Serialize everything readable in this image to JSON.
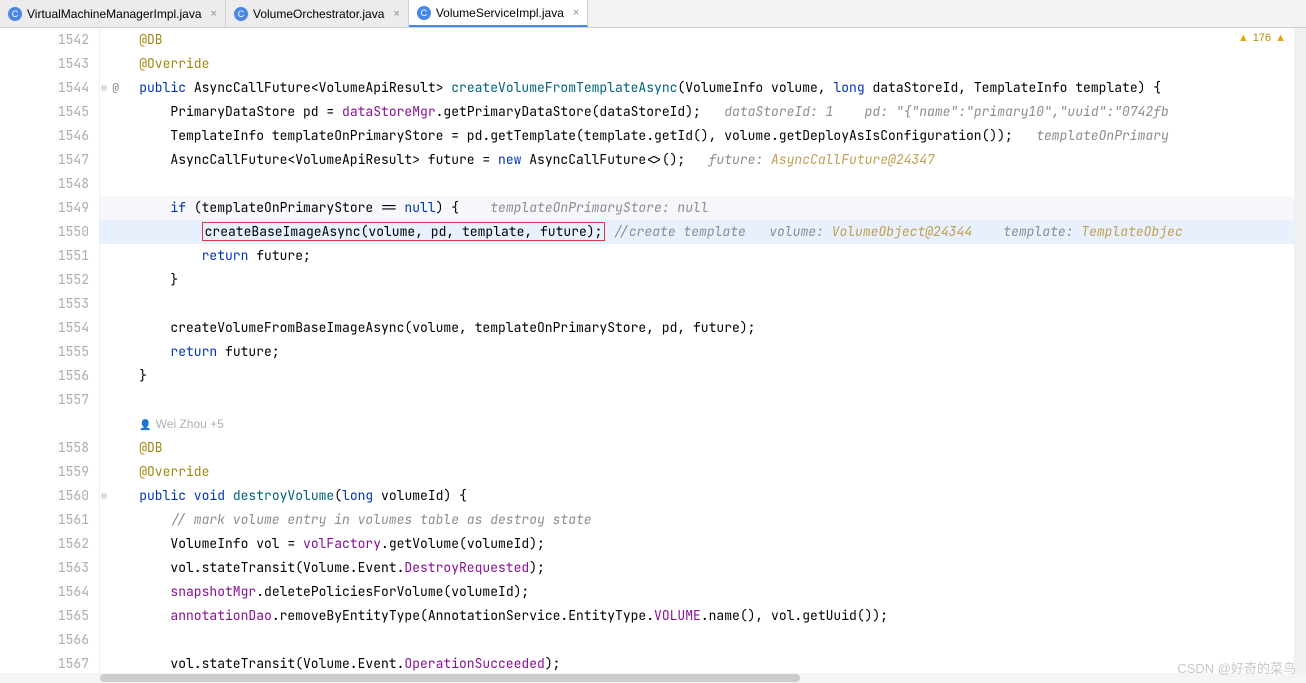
{
  "tabs": [
    {
      "label": "VirtualMachineManagerImpl.java",
      "active": false
    },
    {
      "label": "VolumeOrchestrator.java",
      "active": false
    },
    {
      "label": "VolumeServiceImpl.java",
      "active": true
    }
  ],
  "warn_count": "176",
  "watermark": "CSDN @好奇的菜鸟",
  "author_line": "Wei Zhou +5",
  "gutter_start": 1542,
  "lines": [
    {
      "n": 1542,
      "tokens": [
        [
          "    ",
          ""
        ],
        [
          "@DB",
          "ann"
        ]
      ]
    },
    {
      "n": 1543,
      "tokens": [
        [
          "    ",
          ""
        ],
        [
          "@Override",
          "ann"
        ]
      ]
    },
    {
      "n": 1544,
      "marker": "bp-at",
      "fold": true,
      "tokens": [
        [
          "    ",
          ""
        ],
        [
          "public ",
          "kw"
        ],
        [
          "AsyncCallFuture<VolumeApiResult> ",
          ""
        ],
        [
          "createVolumeFromTemplateAsync",
          "method-def"
        ],
        [
          "(VolumeInfo volume, ",
          ""
        ],
        [
          "long ",
          "kw"
        ],
        [
          "dataStoreId, TemplateInfo template) {",
          ""
        ]
      ]
    },
    {
      "n": 1545,
      "tokens": [
        [
          "        PrimaryDataStore pd = ",
          ""
        ],
        [
          "dataStoreMgr",
          "field"
        ],
        [
          ".getPrimaryDataStore(dataStoreId);   ",
          ""
        ],
        [
          "dataStoreId: 1    pd: \"{\"name\":\"primary10\",\"uuid\":\"0742fb",
          "hint2"
        ]
      ]
    },
    {
      "n": 1546,
      "tokens": [
        [
          "        TemplateInfo templateOnPrimaryStore = pd.getTemplate(template.getId(), volume.getDeployAsIsConfiguration());   ",
          ""
        ],
        [
          "templateOnPrimary",
          "hint2"
        ]
      ]
    },
    {
      "n": 1547,
      "tokens": [
        [
          "        AsyncCallFuture<VolumeApiResult> future = ",
          ""
        ],
        [
          "new ",
          "kw"
        ],
        [
          "AsyncCallFuture<>();   ",
          ""
        ],
        [
          "future: ",
          "hint2"
        ],
        [
          "AsyncCallFuture@24347",
          "hint"
        ]
      ]
    },
    {
      "n": 1548,
      "tokens": [
        [
          "",
          ""
        ]
      ]
    },
    {
      "n": 1549,
      "hl": "hl-line",
      "tokens": [
        [
          "        ",
          ""
        ],
        [
          "if ",
          "kw"
        ],
        [
          "(templateOnPrimaryStore == ",
          ""
        ],
        [
          "null",
          "kw"
        ],
        [
          ") {    ",
          ""
        ],
        [
          "templateOnPrimaryStore: null",
          "hint2"
        ]
      ]
    },
    {
      "n": 1550,
      "hl": "hl-current",
      "box": true,
      "tokens_pre": "            ",
      "boxed": "createBaseImageAsync(volume, pd, template, future);",
      "tokens_post": [
        [
          " ",
          ""
        ],
        [
          "//create template   ",
          "hint2"
        ],
        [
          "volume: ",
          "hint2"
        ],
        [
          "VolumeObject@24344",
          "hint"
        ],
        [
          "    template: ",
          "hint2"
        ],
        [
          "TemplateObjec",
          "hint"
        ]
      ]
    },
    {
      "n": 1551,
      "tokens": [
        [
          "            ",
          ""
        ],
        [
          "return ",
          "kw"
        ],
        [
          "future;",
          ""
        ]
      ]
    },
    {
      "n": 1552,
      "tokens": [
        [
          "        }",
          ""
        ]
      ]
    },
    {
      "n": 1553,
      "tokens": [
        [
          "",
          ""
        ]
      ]
    },
    {
      "n": 1554,
      "tokens": [
        [
          "        createVolumeFromBaseImageAsync(volume, templateOnPrimaryStore, pd, future);",
          ""
        ]
      ]
    },
    {
      "n": 1555,
      "tokens": [
        [
          "        ",
          ""
        ],
        [
          "return ",
          "kw"
        ],
        [
          "future;",
          ""
        ]
      ]
    },
    {
      "n": 1556,
      "tokens": [
        [
          "    }",
          ""
        ]
      ]
    },
    {
      "n": 1557,
      "tokens": [
        [
          "",
          ""
        ]
      ]
    },
    {
      "n": "author",
      "tokens": []
    },
    {
      "n": 1558,
      "tokens": [
        [
          "    ",
          ""
        ],
        [
          "@DB",
          "ann"
        ]
      ]
    },
    {
      "n": 1559,
      "tokens": [
        [
          "    ",
          ""
        ],
        [
          "@Override",
          "ann"
        ]
      ]
    },
    {
      "n": 1560,
      "marker": "bp",
      "fold": true,
      "tokens": [
        [
          "    ",
          ""
        ],
        [
          "public void ",
          "kw"
        ],
        [
          "destroyVolume",
          "method-def"
        ],
        [
          "(",
          ""
        ],
        [
          "long ",
          "kw"
        ],
        [
          "volumeId) {",
          ""
        ]
      ]
    },
    {
      "n": 1561,
      "tokens": [
        [
          "        ",
          ""
        ],
        [
          "// mark volume entry in volumes table as destroy state",
          "comment"
        ]
      ]
    },
    {
      "n": 1562,
      "tokens": [
        [
          "        VolumeInfo vol = ",
          ""
        ],
        [
          "volFactory",
          "field"
        ],
        [
          ".getVolume(volumeId);",
          ""
        ]
      ]
    },
    {
      "n": 1563,
      "tokens": [
        [
          "        vol.stateTransit(Volume.Event.",
          ""
        ],
        [
          "DestroyRequested",
          "field"
        ],
        [
          ");",
          ""
        ]
      ]
    },
    {
      "n": 1564,
      "tokens": [
        [
          "        ",
          ""
        ],
        [
          "snapshotMgr",
          "field"
        ],
        [
          ".deletePoliciesForVolume(volumeId);",
          ""
        ]
      ]
    },
    {
      "n": 1565,
      "tokens": [
        [
          "        ",
          ""
        ],
        [
          "annotationDao",
          "field"
        ],
        [
          ".removeByEntityType(AnnotationService.EntityType.",
          ""
        ],
        [
          "VOLUME",
          "field"
        ],
        [
          ".name(), vol.getUuid());",
          ""
        ]
      ]
    },
    {
      "n": 1566,
      "tokens": [
        [
          "",
          ""
        ]
      ]
    },
    {
      "n": 1567,
      "tokens": [
        [
          "        vol.stateTransit(Volume.Event.",
          ""
        ],
        [
          "OperationSucceeded",
          "field"
        ],
        [
          ");",
          ""
        ]
      ]
    }
  ]
}
